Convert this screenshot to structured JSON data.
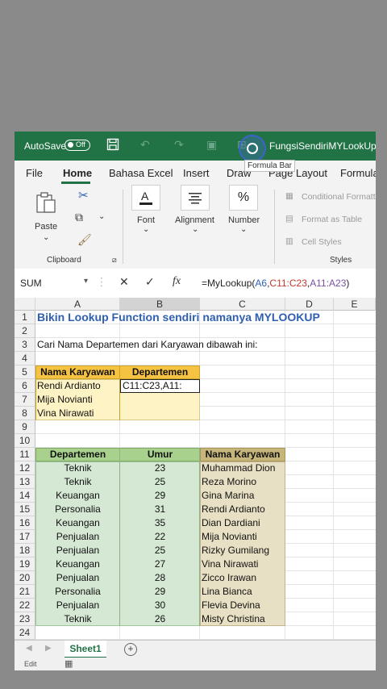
{
  "titlebar": {
    "autosave_label": "AutoSave",
    "autosave_state": "Off",
    "filename": "FungsiSendiriMYLookUp.xls"
  },
  "tabs": [
    "File",
    "Home",
    "Bahasa Excel",
    "Insert",
    "Draw",
    "Page Layout",
    "Formulas"
  ],
  "active_tab": "Home",
  "ribbon": {
    "paste": "Paste",
    "clipboard": "Clipboard",
    "font": "Font",
    "alignment": "Alignment",
    "number": "Number",
    "number_symbol": "%",
    "conditional": "Conditional Formatting",
    "format_table": "Format as Table",
    "cell_styles": "Cell Styles",
    "styles": "Styles"
  },
  "formula_bar": {
    "name_box": "SUM",
    "cancel_icon": "✕",
    "enter_icon": "✓",
    "fx_label": "fx",
    "formula_prefix": "=MyLookup(",
    "formula_ref1": "A6",
    "formula_sep1": ",",
    "formula_ref2": "C11:C23",
    "formula_sep2": ",",
    "formula_ref3": "A11:A23",
    "formula_suffix": ")",
    "tooltip": "Formula Bar"
  },
  "columns": [
    "A",
    "B",
    "C",
    "D",
    "E"
  ],
  "rows": [
    "1",
    "2",
    "3",
    "4",
    "5",
    "6",
    "7",
    "8",
    "9",
    "10",
    "11",
    "12",
    "13",
    "14",
    "15",
    "16",
    "17",
    "18",
    "19",
    "20",
    "21",
    "22",
    "23",
    "24"
  ],
  "sheet": {
    "title": "Bikin Lookup Function sendiri namanya MYLOOKUP",
    "instruction": "Cari Nama Departemen dari Karyawan dibawah ini:",
    "lookup_headers": [
      "Nama Karyawan",
      "Departemen"
    ],
    "lookup_names": [
      "Rendi Ardianto",
      "Mija Novianti",
      "Vina Nirawati"
    ],
    "editing_cell": "C11:C23,A11:",
    "table_headers": [
      "Departemen",
      "Umur",
      "Nama Karyawan"
    ],
    "table_rows": [
      [
        "Teknik",
        "23",
        "Muhammad Dion"
      ],
      [
        "Teknik",
        "25",
        "Reza Morino"
      ],
      [
        "Keuangan",
        "29",
        "Gina Marina"
      ],
      [
        "Personalia",
        "31",
        "Rendi Ardianto"
      ],
      [
        "Keuangan",
        "35",
        "Dian Dardiani"
      ],
      [
        "Penjualan",
        "22",
        "Mija Novianti"
      ],
      [
        "Penjualan",
        "25",
        "Rizky Gumilang"
      ],
      [
        "Keuangan",
        "27",
        "Vina Nirawati"
      ],
      [
        "Penjualan",
        "28",
        "Zicco Irawan"
      ],
      [
        "Personalia",
        "29",
        "Lina Bianca"
      ],
      [
        "Penjualan",
        "30",
        "Flevia Devina"
      ],
      [
        "Teknik",
        "26",
        "Misty Christina"
      ]
    ]
  },
  "sheet_tab": "Sheet1",
  "status": "Edit",
  "colors": {
    "excel_green": "#217346",
    "title_blue": "#2f5fb3",
    "header_yellow": "#f5c242",
    "light_yellow": "#fdf3c4",
    "header_green": "#a9d18e",
    "light_green": "#d5e8d4",
    "col_c_header": "#c7b67a",
    "col_c_fill": "#e8e0c4"
  }
}
